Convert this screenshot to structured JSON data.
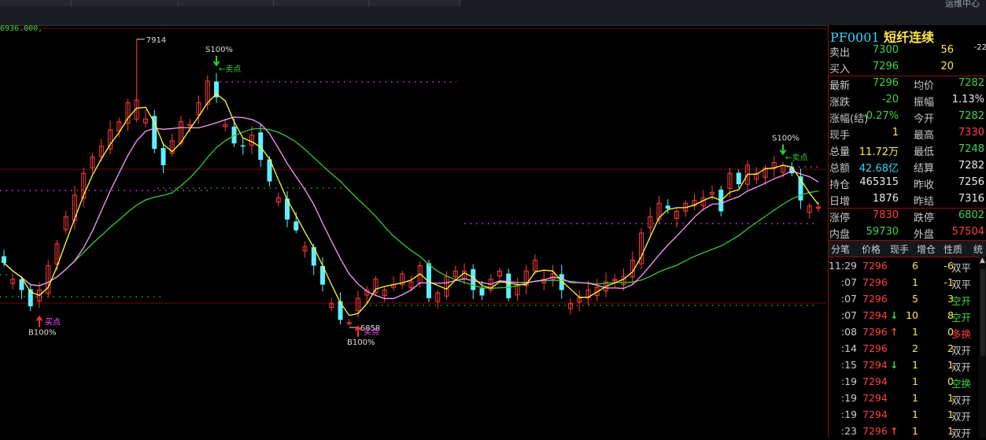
{
  "topbar": {
    "right_text": "运维中心"
  },
  "chart": {
    "ma_label": "6936.000,",
    "high_marker": "7914",
    "low_marker": "6858",
    "signals": [
      {
        "top": "S100%",
        "label": "卖点"
      },
      {
        "top": "S100%",
        "label": "卖点"
      },
      {
        "bottom": "B100%",
        "label": "买点"
      },
      {
        "bottom": "B100%",
        "label": "买点"
      }
    ],
    "colors": {
      "up": "#ff3b3b",
      "down": "#5ff0ff",
      "ma5": "#ffff33",
      "ma10": "#ff99ff",
      "ma60": "#33cc33",
      "sell_dots": "#ff55ff",
      "level_dots": "#33cc33"
    }
  },
  "chart_data": {
    "type": "candlestick",
    "symbol": "PF0001",
    "high_label": 7914,
    "low_label": 6858,
    "ma_value": 6936.0,
    "close": [
      7090,
      7030,
      6990,
      6930,
      6990,
      7080,
      7160,
      7260,
      7340,
      7420,
      7480,
      7520,
      7580,
      7610,
      7680,
      7690,
      7620,
      7510,
      7450,
      7540,
      7610,
      7600,
      7680,
      7760,
      7700,
      7600,
      7530,
      7520,
      7560,
      7470,
      7390,
      7330,
      7250,
      7210,
      7150,
      7080,
      7010,
      6940,
      6880,
      6870,
      6960,
      6990,
      7030,
      6990,
      7010,
      7050,
      7020,
      7080,
      6960,
      6980,
      7040,
      7060,
      7060,
      6990,
      6970,
      7030,
      7060,
      6960,
      7010,
      7060,
      7100,
      7030,
      7050,
      6990,
      6940,
      6960,
      6990,
      7000,
      7020,
      7030,
      7040,
      7100,
      7200,
      7260,
      7310,
      7290,
      7280,
      7310,
      7320,
      7330,
      7350,
      7280,
      7420,
      7380,
      7450,
      7420,
      7440,
      7460,
      7450,
      7420,
      7320,
      7300,
      7296
    ],
    "signals": [
      {
        "type": "buy",
        "text": "买点",
        "pct": "B100%"
      },
      {
        "type": "sell",
        "text": "卖点",
        "pct": "S100%"
      },
      {
        "type": "buy",
        "text": "买点",
        "pct": "B100%"
      },
      {
        "type": "sell",
        "text": "卖点",
        "pct": "S100%"
      }
    ]
  },
  "quote": {
    "code": "PF0001",
    "name": "短纤连续",
    "rows": [
      {
        "l1": "卖出",
        "v1": "7300",
        "v1c": "green",
        "v2": "56",
        "v2c": "yellow",
        "v3": "-22",
        "v3c": "white"
      },
      {
        "l1": "买入",
        "v1": "7296",
        "v1c": "green",
        "v2": "20",
        "v2c": "yellow",
        "v3": "",
        "v3c": "white"
      },
      {
        "l1": "最新",
        "v1": "7296",
        "v1c": "green",
        "l2": "均价",
        "v2": "7282",
        "v2c": "green"
      },
      {
        "l1": "涨跌",
        "v1": "-20",
        "v1c": "green",
        "l2": "振幅",
        "v2": "1.13%",
        "v2c": "white"
      },
      {
        "l1": "涨幅(结)",
        "v1": "-0.27%",
        "v1c": "green",
        "l2": "今开",
        "v2": "7282",
        "v2c": "green"
      },
      {
        "l1": "现手",
        "v1": "1",
        "v1c": "yellow",
        "l2": "最高",
        "v2": "7330",
        "v2c": "red"
      },
      {
        "l1": "总量",
        "v1": "11.72万",
        "v1c": "yellow",
        "l2": "最低",
        "v2": "7248",
        "v2c": "green"
      },
      {
        "l1": "总额",
        "v1": "42.68亿",
        "v1c": "cyan",
        "l2": "结算",
        "v2": "7282",
        "v2c": "white"
      },
      {
        "l1": "持仓",
        "v1": "465315",
        "v1c": "white",
        "l2": "昨收",
        "v2": "7256",
        "v2c": "white"
      },
      {
        "l1": "日增",
        "v1": "1876",
        "v1c": "white",
        "l2": "昨结",
        "v2": "7316",
        "v2c": "white"
      },
      {
        "l1": "涨停",
        "v1": "7830",
        "v1c": "red",
        "l2": "跌停",
        "v2": "6802",
        "v2c": "green"
      },
      {
        "l1": "内盘",
        "v1": "59730",
        "v1c": "green",
        "l2": "外盘",
        "v2": "57504",
        "v2c": "red"
      }
    ]
  },
  "ticks": {
    "tabs": [
      "分笔",
      "价格",
      "现手",
      "增仓",
      "性质",
      "统"
    ],
    "rows": [
      {
        "time": "11:29",
        "price": "7296",
        "arrow": "",
        "vol": "6",
        "delta": "-6",
        "nature": "双平"
      },
      {
        "time": ":07",
        "price": "7296",
        "arrow": "",
        "vol": "1",
        "delta": "-1",
        "nature": "双平"
      },
      {
        "time": ":07",
        "price": "7296",
        "arrow": "",
        "vol": "5",
        "delta": "3",
        "nature": "空开"
      },
      {
        "time": ":07",
        "price": "7294",
        "arrow": "down",
        "vol": "10",
        "delta": "8",
        "nature": "空开"
      },
      {
        "time": ":08",
        "price": "7296",
        "arrow": "up",
        "vol": "1",
        "delta": "0",
        "nature": "多换"
      },
      {
        "time": ":14",
        "price": "7296",
        "arrow": "",
        "vol": "2",
        "delta": "2",
        "nature": "双开"
      },
      {
        "time": ":15",
        "price": "7294",
        "arrow": "down",
        "vol": "1",
        "delta": "1",
        "nature": "双开"
      },
      {
        "time": ":19",
        "price": "7294",
        "arrow": "",
        "vol": "1",
        "delta": "0",
        "nature": "空换"
      },
      {
        "time": ":19",
        "price": "7294",
        "arrow": "",
        "vol": "1",
        "delta": "1",
        "nature": "双开"
      },
      {
        "time": ":19",
        "price": "7294",
        "arrow": "",
        "vol": "1",
        "delta": "1",
        "nature": "双开"
      },
      {
        "time": ":23",
        "price": "7296",
        "arrow": "up",
        "vol": "1",
        "delta": "1",
        "nature": "双开"
      }
    ]
  }
}
